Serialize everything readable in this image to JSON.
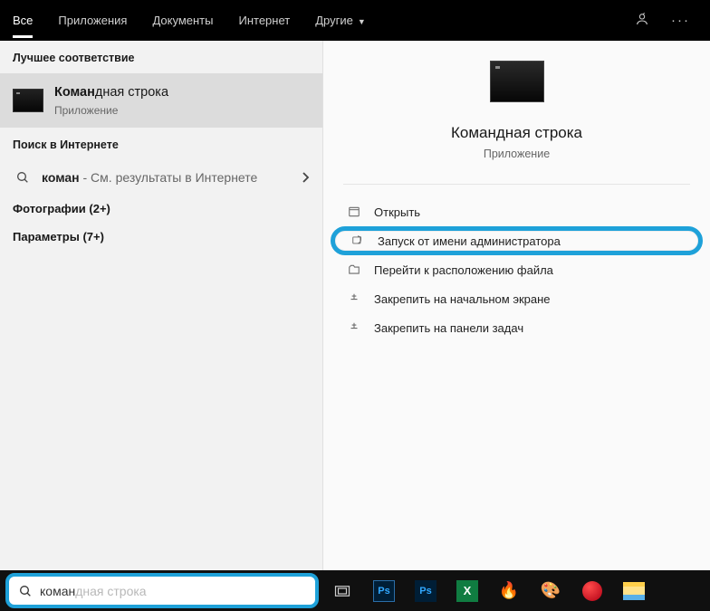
{
  "tabs": {
    "all": "Все",
    "apps": "Приложения",
    "docs": "Документы",
    "web": "Интернет",
    "more": "Другие"
  },
  "left": {
    "best_header": "Лучшее соответствие",
    "best_title_hl": "Коман",
    "best_title_rest": "дная строка",
    "best_sub": "Приложение",
    "web_header": "Поиск в Интернете",
    "web_hl": "коман",
    "web_rest": " - См. результаты в Интернете",
    "photos": "Фотографии (2+)",
    "params": "Параметры (7+)"
  },
  "preview": {
    "title": "Командная строка",
    "sub": "Приложение",
    "actions": {
      "open": "Открыть",
      "run_admin": "Запуск от имени администратора",
      "open_location": "Перейти к расположению файла",
      "pin_start": "Закрепить на начальном экране",
      "pin_taskbar": "Закрепить на панели задач"
    }
  },
  "search": {
    "typed": "коман",
    "ghost": "дная строка"
  }
}
